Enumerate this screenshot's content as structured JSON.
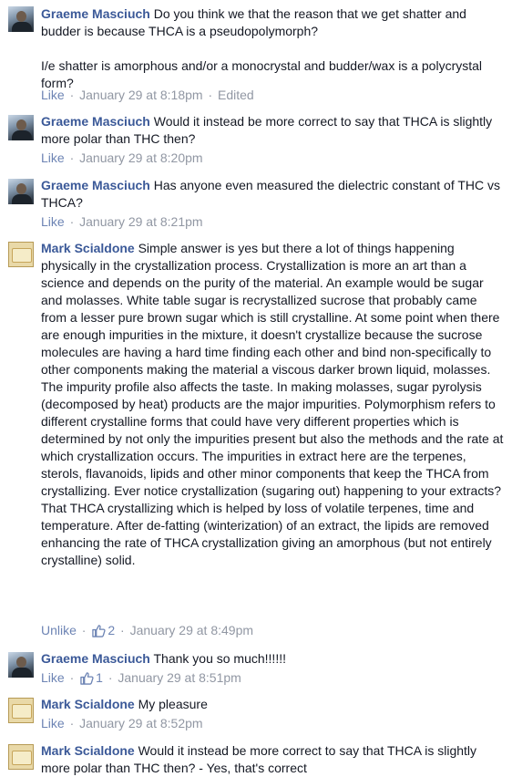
{
  "comments": [
    {
      "author": "Graeme Masciuch",
      "avatar_icon": "graeme-avatar",
      "paragraphs": [
        "Do you think we that the reason that we get shatter and budder is because THCA is a pseudopolymorph?",
        "I/e shatter is amorphous and/or a monocrystal and budder/wax is a polycrystal form?"
      ],
      "actions": {
        "like": "Like",
        "sep": "·",
        "time": "January 29 at 8:18pm",
        "edited": "Edited"
      }
    },
    {
      "author": "Graeme Masciuch",
      "avatar_icon": "graeme-avatar",
      "paragraphs": [
        "Would it instead be more correct to say that THCA is slightly more polar than THC then?"
      ],
      "actions": {
        "like": "Like",
        "sep": "·",
        "time": "January 29 at 8:20pm"
      }
    },
    {
      "author": "Graeme Masciuch",
      "avatar_icon": "graeme-avatar",
      "paragraphs": [
        "Has anyone even measured the dielectric constant of THC vs THCA?"
      ],
      "actions": {
        "like": "Like",
        "sep": "·",
        "time": "January 29 at 8:21pm"
      }
    },
    {
      "author": "Mark Scialdone",
      "avatar_icon": "mark-avatar",
      "paragraphs": [
        "Simple answer is yes but there a lot of things happening physically in the crystallization process. Crystallization is more an art than a science and depends on the purity of the material. An example would be sugar and molasses. White table sugar is recrystallized sucrose that probably came from a lesser pure brown sugar which is still crystalline. At some point when there are enough impurities in the mixture, it doesn't crystallize because the sucrose molecules are having a hard time finding each other and bind non-specifically to other components making the material a viscous darker brown liquid, molasses. The impurity profile also affects the taste. In making molasses, sugar pyrolysis (decomposed by heat) products are the major impurities. Polymorphism refers to different crystalline forms that could have very different properties which is determined by not only the impurities present but also the methods and the rate at which crystallization occurs. The impurities in extract here are the terpenes, sterols, flavanoids, lipids and other minor components that keep the THCA from crystallizing. Ever notice crystallization (sugaring out) happening to your extracts? That THCA crystallizing which is helped by loss of volatile terpenes, time and temperature. After de-fatting (winterization) of an extract, the lipids are removed enhancing the rate of THCA crystallization giving an amorphous (but not entirely crystalline) solid."
      ],
      "actions": {
        "like": "Unlike",
        "sep": "·",
        "likes": "2",
        "time": "January 29 at 8:49pm"
      }
    },
    {
      "author": "Graeme Masciuch",
      "avatar_icon": "graeme-avatar",
      "paragraphs": [
        "Thank you so much!!!!!!"
      ],
      "actions": {
        "like": "Like",
        "sep": "·",
        "likes": "1",
        "time": "January 29 at 8:51pm"
      }
    },
    {
      "author": "Mark Scialdone",
      "avatar_icon": "mark-avatar",
      "paragraphs": [
        "My pleasure"
      ],
      "actions": {
        "like": "Like",
        "sep": "·",
        "time": "January 29 at 8:52pm"
      }
    },
    {
      "author": "Mark Scialdone",
      "avatar_icon": "mark-avatar",
      "paragraphs": [
        "Would it instead be more correct to say that THCA is slightly more polar than THC then? - Yes, that's correct"
      ],
      "actions": null
    }
  ],
  "colors": {
    "author": "#3b5998",
    "link": "#6d84b4",
    "meta": "#9197a3",
    "text": "#141823"
  }
}
